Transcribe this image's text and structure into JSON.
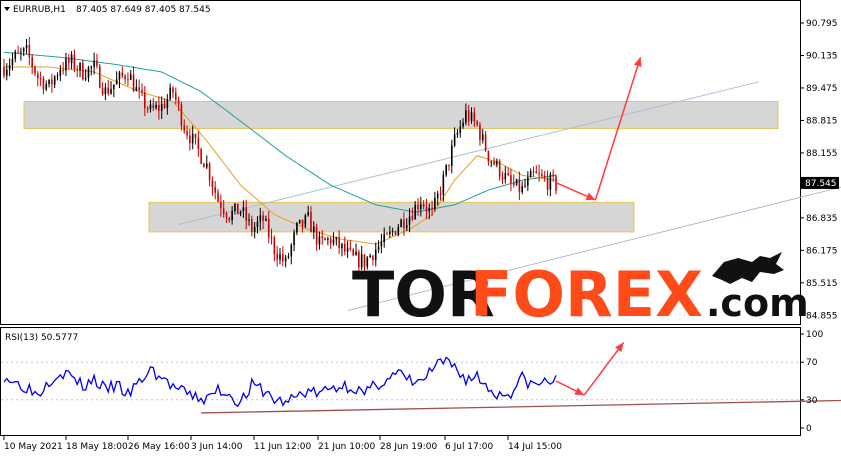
{
  "header": {
    "symbol": "EURRUB,H1",
    "ohlc": "87.405 87.649 87.405 87.545"
  },
  "rsi_header": "RSI(13) 50.5777",
  "logo": {
    "part1": "TOR",
    "part2": "FOREX",
    "part3": ".com"
  },
  "colors": {
    "candle_up": "#000000",
    "candle_down": "#cc0000",
    "ma_fast": "#e6a020",
    "ma_slow": "#20a0a0",
    "channel": "#a9bfd6",
    "zone_fill": "#d6d6d6",
    "zone_border": "#e8c45a",
    "arrow": "#ff3b3b",
    "rsi": "#0000ee",
    "rsi_trend": "#a0504f",
    "price_tag": "#000000"
  },
  "chart_data": [
    {
      "type": "candlestick",
      "panel": "price",
      "symbol": "EURRUB",
      "timeframe": "H1",
      "y_ticks": [
        90.795,
        90.135,
        89.475,
        88.815,
        88.155,
        87.545,
        86.835,
        86.175,
        85.515,
        84.855
      ],
      "current_price": 87.545,
      "ylim": [
        84.8,
        91.1
      ],
      "x_ticks": [
        "10 May 2021",
        "18 May 18:00",
        "26 May 16:00",
        "3 Jun 14:00",
        "11 Jun 12:00",
        "21 Jun 10:00",
        "28 Jun 19:00",
        "6 Jul 17:00",
        "14 Jul 15:00"
      ],
      "price_path": [
        [
          0,
          89.9
        ],
        [
          4,
          90.1
        ],
        [
          8,
          90.2
        ],
        [
          12,
          89.7
        ],
        [
          16,
          89.5
        ],
        [
          20,
          89.9
        ],
        [
          24,
          90.0
        ],
        [
          28,
          89.8
        ],
        [
          32,
          89.9
        ],
        [
          36,
          89.4
        ],
        [
          40,
          89.6
        ],
        [
          44,
          89.8
        ],
        [
          48,
          89.3
        ],
        [
          52,
          89.0
        ],
        [
          56,
          89.1
        ],
        [
          60,
          89.4
        ],
        [
          64,
          88.7
        ],
        [
          68,
          88.3
        ],
        [
          72,
          87.9
        ],
        [
          76,
          87.2
        ],
        [
          80,
          86.9
        ],
        [
          84,
          87.0
        ],
        [
          88,
          86.6
        ],
        [
          92,
          86.8
        ],
        [
          96,
          86.2
        ],
        [
          100,
          85.9
        ],
        [
          104,
          86.6
        ],
        [
          108,
          86.8
        ],
        [
          112,
          86.3
        ],
        [
          116,
          86.4
        ],
        [
          120,
          86.2
        ],
        [
          124,
          86.0
        ],
        [
          128,
          85.95
        ],
        [
          132,
          86.2
        ],
        [
          136,
          86.4
        ],
        [
          140,
          86.7
        ],
        [
          144,
          86.9
        ],
        [
          148,
          87.2
        ],
        [
          152,
          86.9
        ],
        [
          156,
          87.6
        ],
        [
          160,
          88.4
        ],
        [
          164,
          88.95
        ],
        [
          168,
          88.7
        ],
        [
          172,
          88.1
        ],
        [
          176,
          87.8
        ],
        [
          180,
          87.5
        ],
        [
          184,
          87.4
        ],
        [
          188,
          87.7
        ],
        [
          192,
          87.6
        ],
        [
          196,
          87.5
        ]
      ],
      "ma_fast_path": [
        [
          0,
          89.9
        ],
        [
          16,
          89.9
        ],
        [
          32,
          89.8
        ],
        [
          48,
          89.4
        ],
        [
          60,
          89.2
        ],
        [
          72,
          88.4
        ],
        [
          84,
          87.5
        ],
        [
          96,
          86.9
        ],
        [
          108,
          86.6
        ],
        [
          120,
          86.4
        ],
        [
          132,
          86.3
        ],
        [
          144,
          86.6
        ],
        [
          152,
          86.9
        ],
        [
          160,
          87.6
        ],
        [
          168,
          88.1
        ],
        [
          176,
          87.95
        ],
        [
          184,
          87.7
        ],
        [
          196,
          87.6
        ]
      ],
      "ma_slow_path": [
        [
          0,
          90.2
        ],
        [
          20,
          90.1
        ],
        [
          40,
          89.95
        ],
        [
          56,
          89.8
        ],
        [
          70,
          89.4
        ],
        [
          84,
          88.8
        ],
        [
          100,
          88.1
        ],
        [
          116,
          87.5
        ],
        [
          132,
          87.1
        ],
        [
          146,
          86.95
        ],
        [
          160,
          87.1
        ],
        [
          172,
          87.4
        ],
        [
          184,
          87.6
        ],
        [
          196,
          87.7
        ]
      ],
      "channel_lines": [
        {
          "from": [
            62,
            86.7
          ],
          "to": [
            268,
            89.6
          ]
        },
        {
          "from": [
            122,
            84.95
          ],
          "to": [
            328,
            87.9
          ]
        }
      ],
      "resistance_zone": [
        88.65,
        89.2
      ],
      "support_zone": [
        86.55,
        87.15
      ],
      "forecast_arrows": [
        {
          "from": [
            196,
            87.55
          ],
          "to": [
            210,
            87.2
          ]
        },
        {
          "from": [
            210,
            87.2
          ],
          "to": [
            226,
            90.1
          ]
        }
      ]
    },
    {
      "type": "line",
      "panel": "oscillator",
      "name": "RSI(13)",
      "current_value": 50.5777,
      "y_ticks": [
        100,
        70,
        30,
        0
      ],
      "levels": [
        70,
        30
      ],
      "ylim": [
        0,
        100
      ],
      "rsi_path": [
        [
          0,
          56
        ],
        [
          4,
          48
        ],
        [
          8,
          44
        ],
        [
          12,
          36
        ],
        [
          16,
          51
        ],
        [
          20,
          60
        ],
        [
          24,
          55
        ],
        [
          28,
          44
        ],
        [
          32,
          52
        ],
        [
          36,
          40
        ],
        [
          40,
          46
        ],
        [
          44,
          35
        ],
        [
          48,
          48
        ],
        [
          52,
          62
        ],
        [
          56,
          53
        ],
        [
          60,
          44
        ],
        [
          64,
          37
        ],
        [
          68,
          33
        ],
        [
          72,
          30
        ],
        [
          76,
          41
        ],
        [
          80,
          36
        ],
        [
          84,
          27
        ],
        [
          88,
          45
        ],
        [
          92,
          40
        ],
        [
          96,
          30
        ],
        [
          100,
          27
        ],
        [
          104,
          34
        ],
        [
          108,
          40
        ],
        [
          112,
          36
        ],
        [
          116,
          42
        ],
        [
          120,
          45
        ],
        [
          124,
          44
        ],
        [
          128,
          35
        ],
        [
          132,
          46
        ],
        [
          136,
          52
        ],
        [
          140,
          58
        ],
        [
          144,
          50
        ],
        [
          148,
          48
        ],
        [
          152,
          62
        ],
        [
          156,
          70
        ],
        [
          160,
          65
        ],
        [
          164,
          52
        ],
        [
          168,
          55
        ],
        [
          172,
          42
        ],
        [
          176,
          35
        ],
        [
          180,
          38
        ],
        [
          184,
          53
        ],
        [
          188,
          45
        ],
        [
          192,
          49
        ],
        [
          196,
          51
        ]
      ],
      "trendline": {
        "from": [
          70,
          16
        ],
        "to": [
          310,
          30
        ]
      },
      "forecast_arrows": [
        {
          "from": [
            196,
            50
          ],
          "to": [
            206,
            35
          ]
        },
        {
          "from": [
            206,
            35
          ],
          "to": [
            220,
            91
          ]
        }
      ]
    }
  ]
}
